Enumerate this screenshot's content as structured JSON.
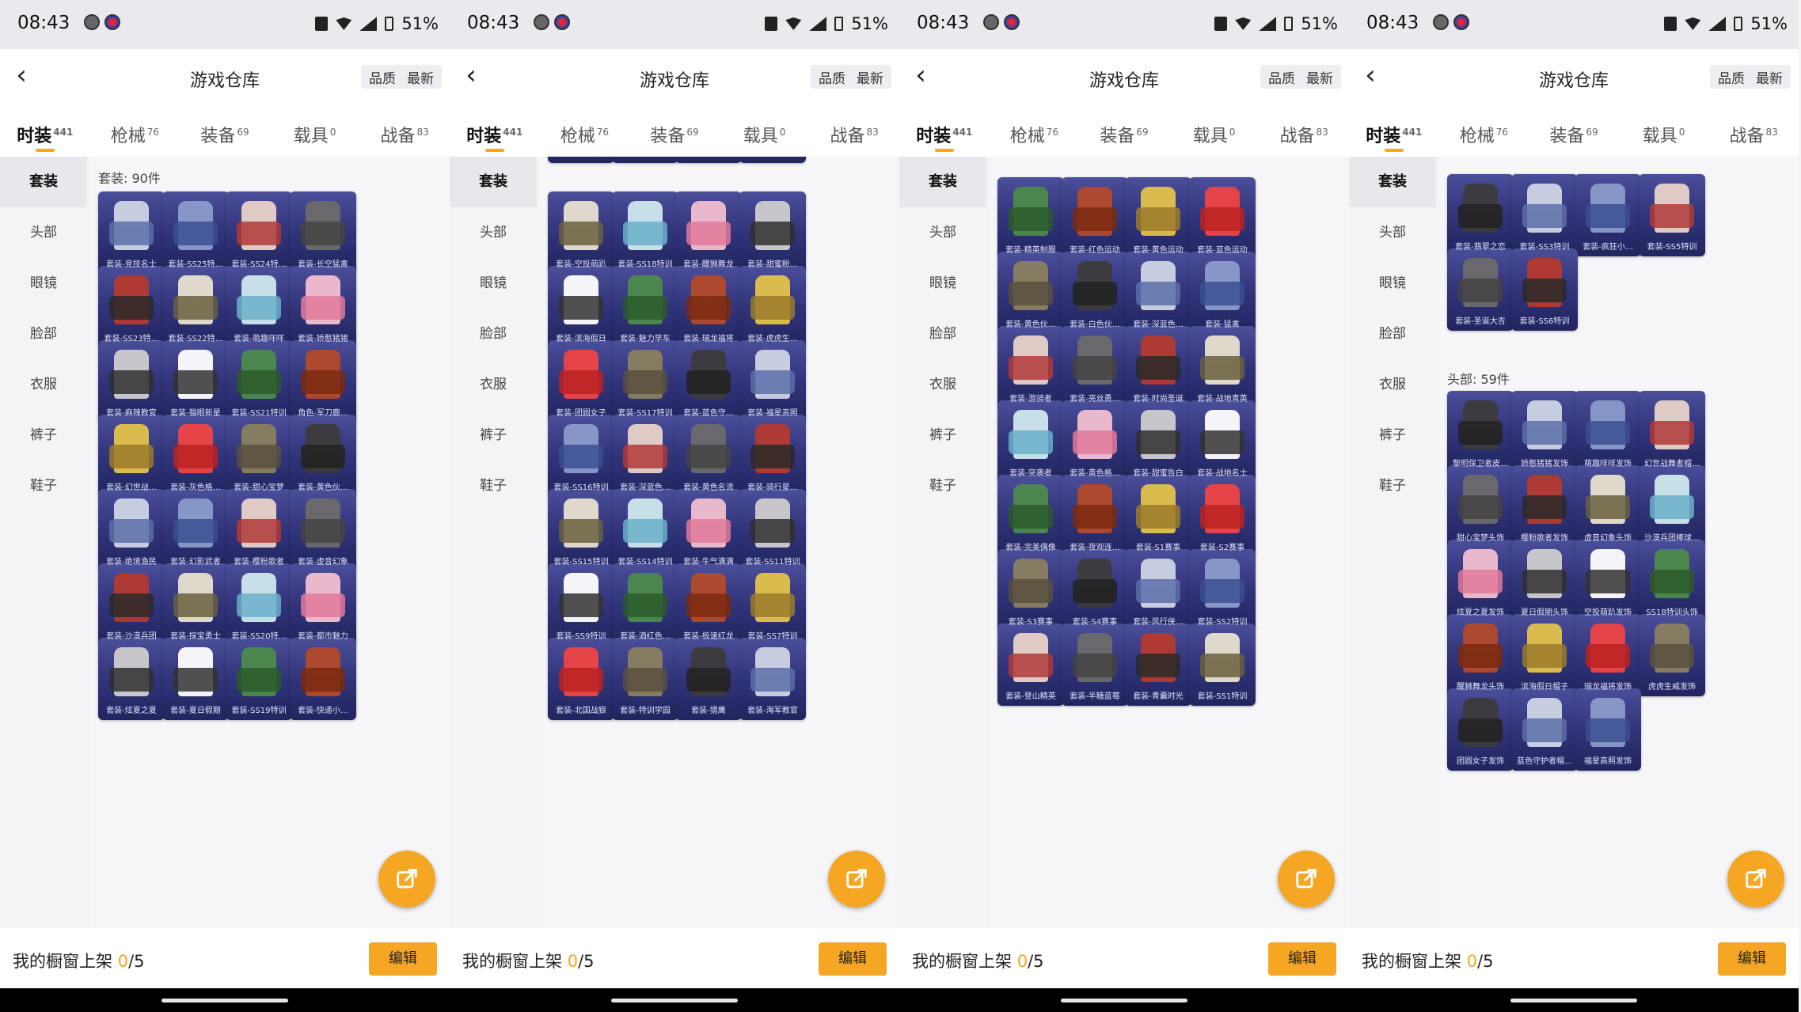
{
  "status": {
    "time": "08:43",
    "battery": "51%"
  },
  "header": {
    "title": "游戏仓库",
    "sort_quality": "品质",
    "sort_newest": "最新"
  },
  "tabs": [
    {
      "label": "时装",
      "count": "441"
    },
    {
      "label": "枪械",
      "count": "76"
    },
    {
      "label": "装备",
      "count": "69"
    },
    {
      "label": "载具",
      "count": "0"
    },
    {
      "label": "战备",
      "count": "83"
    }
  ],
  "sidebar": [
    "套装",
    "头部",
    "眼镜",
    "脸部",
    "衣服",
    "裤子",
    "鞋子"
  ],
  "bottom": {
    "label": "我的橱窗上架 ",
    "count_current": "0",
    "count_total": "/5",
    "edit": "编辑"
  },
  "panels": [
    {
      "section": "套装: 90件",
      "items": [
        "套装-竞技名士",
        "套装-SS25特…",
        "套装-SS24特…",
        "套装-长空猛禽",
        "套装-SS23特…",
        "套装-SS22特…",
        "套装-萌趣咩咩",
        "套装-娇憨猪猪",
        "套装-麻辣教官",
        "套装-猫眼新星",
        "套装-SS21特训",
        "角色-军刀鹿…",
        "套装-幻世战…",
        "套装-灰色格…",
        "套装-甜心宝梦",
        "套装-黄色伙…",
        "套装-绝境渔民",
        "套装-幻影武者",
        "套装-樱粉歌者",
        "套装-虚音幻象",
        "套装-沙漠兵团",
        "套装-探宝勇士",
        "套装-SS20特…",
        "套装-都市魅力",
        "套装-炫夏之夏",
        "套装-夏日假期",
        "套装-SS19特训",
        "套装-快递小…"
      ]
    },
    {
      "items": [
        "套装-空投萌趴",
        "套装-SS18特训",
        "套装-醒狮舞龙",
        "套装-甜蜜粉…",
        "套装-滨海假日",
        "套装-魅力早车",
        "套装-瑞龙福将",
        "套装-虎虎生…",
        "套装-团圆女子",
        "套装-SS17特训",
        "套装-蓝色守…",
        "套装-福星高照",
        "套装-SS16特训",
        "套装-深蓝色…",
        "套装-黄色名流",
        "套装-骑行星…",
        "套装-SS15特训",
        "套装-SS14特训",
        "套装-牛气满满",
        "套装-SS11特训",
        "套装-SS9特训",
        "套装-酒红色…",
        "套装-极速红龙",
        "套装-SS7特训",
        "套装-北国战狼",
        "套装-特训学园",
        "套装-猎鹰",
        "套装-海军教官"
      ]
    },
    {
      "items": [
        "套装-精英制服",
        "套装-红色运动",
        "套装-黄色运动",
        "套装-蓝色运动",
        "套装-黄色伙…",
        "套装-白色伙…",
        "套装-深蓝色…",
        "套装-猛禽",
        "套装-游骑者",
        "套装-亮丝勇…",
        "套装-时尚圣诞",
        "套装-战地青英",
        "套装-突袭者",
        "套装-黄色格…",
        "套装-甜蜜告白",
        "套装-战地名士",
        "套装-完美偶像",
        "套装-夜观连…",
        "套装-S1赛事",
        "套装-S2赛事",
        "套装-S3赛事",
        "套装-S4赛事",
        "套装-风行侠…",
        "套装-SS2特训",
        "套装-登山精英",
        "套装-半糖蓝莓",
        "套装-青囊时光",
        "套装-SS1特训"
      ]
    },
    {
      "top_items": [
        "套装-翡翠之恋",
        "套装-SS3特训",
        "套装-疯狂小…",
        "套装-SS5特训",
        "套装-圣诞大吉",
        "套装-SS6特训"
      ],
      "section": "头部: 59件",
      "items": [
        "黎明保卫者皮…",
        "娇憨猪猪发饰",
        "萌趣咩咩发饰",
        "幻世战舞者帽…",
        "甜心宝梦头饰",
        "樱粉歌者发饰",
        "虚音幻象头饰",
        "沙漠兵团棒球…",
        "炫夏之夏发饰",
        "夏日假期头饰",
        "空投萌趴发饰",
        "SS18特训头饰",
        "醒狮舞龙头饰",
        "滨海假日帽子",
        "瑞龙福将发饰",
        "虎虎生威发饰",
        "团圆女子发饰",
        "蓝色守护者帽…",
        "福星高照发饰"
      ]
    }
  ]
}
